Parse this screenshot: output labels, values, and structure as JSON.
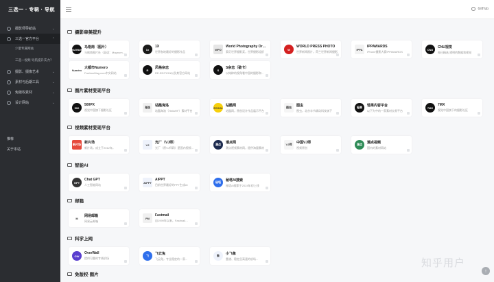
{
  "brand": "三选一 · 专辑 · 导航",
  "sidebar": {
    "items": [
      {
        "label": "摄影师导航站",
        "has_chevron": true
      },
      {
        "label": "三选一官方平台",
        "has_chevron": true,
        "active": true
      },
      {
        "label": "摄影、摄像艺术",
        "has_chevron": true
      },
      {
        "label": "素材与后期工具",
        "has_chevron": true
      },
      {
        "label": "免版权素材",
        "has_chevron": true
      },
      {
        "label": "设计网站",
        "has_chevron": true
      }
    ],
    "sub_items": [
      "少量专属网站",
      "三选一视频·导航提升实力？"
    ],
    "footer": [
      "推荐",
      "关于本站"
    ]
  },
  "topbar": {
    "github_label": "GitHub"
  },
  "sections": [
    {
      "title": "摄影审美提升",
      "cards": [
        {
          "title": "马格南（图片）",
          "desc": "马格南图片社（英语：Magnum Photos）",
          "logo": "MAGNUM",
          "color": "#111111",
          "round": true
        },
        {
          "title": "1X",
          "desc": "世界各地最好的摄影作品",
          "logo": "1x",
          "color": "#1a1a1a",
          "round": true
        },
        {
          "title": "World Photography Orga...",
          "desc": "索尼世界摄影奖，世界摄影组织",
          "logo": "WPO",
          "color": "#e6e6e6",
          "round": false
        },
        {
          "title": "WORLD PRESS PHOTO",
          "desc": "世界新闻照片，荷兰世界新闻摄影",
          "logo": "W",
          "color": "#d42020",
          "round": true
        },
        {
          "title": "IPPAWARDS",
          "desc": "iPhone摄影大赛IPPAWARDS",
          "logo": "IPPA",
          "color": "#f2f2f2",
          "round": false
        },
        {
          "title": "CNU视觉",
          "desc": "每日精选 透明的数据和视觉",
          "logo": "CNU",
          "color": "#111111",
          "round": true
        },
        {
          "title": "大都市Numero",
          "desc": "FashionMag.com中文网站",
          "logo": "Numéro",
          "color": "#ffffff",
          "round": false
        },
        {
          "title": "风格杂志",
          "desc": "RE-EDITION以及其官方网站",
          "logo": "R",
          "color": "#111111",
          "round": true
        },
        {
          "title": "S杂志（破卡）",
          "desc": "以纯粹的视角看中国的摄影和...",
          "logo": "S",
          "color": "#111111",
          "round": true
        }
      ]
    },
    {
      "title": "图片素材变现平台",
      "cards": [
        {
          "title": "500PX",
          "desc": "视觉中国旗下摄影社区",
          "logo": "500",
          "color": "#111111",
          "round": true
        },
        {
          "title": "站酷海洛",
          "desc": "站酷海洛（HelloRF）素材平台",
          "logo": "海洛",
          "color": "#f0f0f0",
          "round": false
        },
        {
          "title": "站酷网",
          "desc": "站酷网，原创设计作品展示平台",
          "logo": "ZCOOL",
          "color": "#f7d00c",
          "round": true
        },
        {
          "title": "图虫",
          "desc": "图虫，北京字节跳动科技旗下",
          "logo": "图虫",
          "color": "#f5f5f5",
          "round": false
        },
        {
          "title": "轻果内容平台",
          "desc": "以下为中的一家素材交易平台",
          "logo": "轻果",
          "color": "#111111",
          "round": true
        },
        {
          "title": "7MX",
          "desc": "视觉中国旗下的摄影社区",
          "logo": "7MX",
          "color": "#111111",
          "round": true
        }
      ]
    },
    {
      "title": "视频素材变现平台",
      "cards": [
        {
          "title": "新片场",
          "desc": "新片场，成立于2012年，",
          "logo": "新片场",
          "color": "#e64a3c",
          "round": false
        },
        {
          "title": "光厂（VJ师）",
          "desc": "光厂（原VJ师网）是国内视频素材",
          "logo": "VJ",
          "color": "#eef2fb",
          "round": false
        },
        {
          "title": "潮点网",
          "desc": "潮点视频素材网，提供海量素材",
          "logo": "潮点",
          "color": "#1d2b4f",
          "round": true
        },
        {
          "title": "中国VJ师",
          "desc": "视频原创",
          "logo": "VJ师",
          "color": "#f5f5f5",
          "round": false
        },
        {
          "title": "潮点视频",
          "desc": "国内的素材网站",
          "logo": "潮点",
          "color": "#2e8b57",
          "round": true
        }
      ]
    },
    {
      "title": "智能AI",
      "cards": [
        {
          "title": "Chat GPT",
          "desc": "人工智能网站",
          "logo": "GPT",
          "color": "#333333",
          "round": true
        },
        {
          "title": "AIPPT",
          "desc": "目前世界最好的PPT生成AI",
          "logo": "AIPPT",
          "color": "#eef2fb",
          "round": false
        },
        {
          "title": "秘塔AI搜索",
          "desc": "秘塔AI搜索于2024年初上线",
          "logo": "秘塔",
          "color": "#2f6fec",
          "round": true
        }
      ]
    },
    {
      "title": "邮箱",
      "cards": [
        {
          "title": "网易邮箱",
          "desc": "网易云邮箱",
          "logo": "M",
          "color": "#ffffff",
          "round": false
        },
        {
          "title": "Fastmail",
          "desc": "自1999年以来，Fastmail…",
          "logo": "FM",
          "color": "#f0f0f0",
          "round": false
        }
      ]
    },
    {
      "title": "科学上网",
      "cards": [
        {
          "title": "OverWall",
          "desc": "提供可靠的专线机场",
          "logo": "OW",
          "color": "#5a3fcf",
          "round": true
        },
        {
          "title": "飞云兔",
          "desc": "飞云兔，专业稳定的一家...",
          "logo": "飞",
          "color": "#2f6fec",
          "round": true
        },
        {
          "title": "小飞象",
          "desc": "靠谱、稳定且高速的机场...",
          "logo": "象",
          "color": "#eef2fb",
          "round": true
        }
      ]
    },
    {
      "title": "免版权·图片",
      "cards": []
    }
  ],
  "watermark": "知乎用户",
  "fab_icon": "arrow-up-icon"
}
